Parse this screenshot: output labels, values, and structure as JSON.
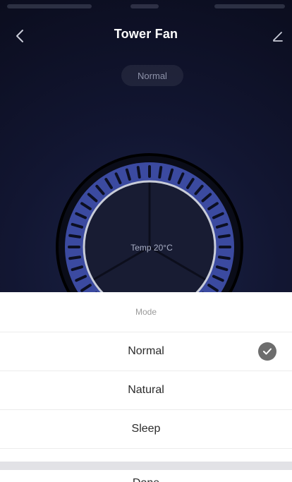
{
  "header": {
    "title": "Tower Fan",
    "current_mode": "Normal"
  },
  "fan": {
    "center_label": "Temp 20°C"
  },
  "mode_sheet": {
    "title": "Mode",
    "options": [
      {
        "label": "Normal",
        "selected": true
      },
      {
        "label": "Natural",
        "selected": false
      },
      {
        "label": "Sleep",
        "selected": false
      }
    ],
    "done_label": "Done"
  },
  "colors": {
    "background": "#121632",
    "dial_blue": "#3b4aa0",
    "sheet": "#ffffff",
    "check": "#6d6d6d"
  },
  "icons": {
    "back": "chevron-left-icon",
    "edit": "pencil-icon",
    "check": "checkmark-icon"
  }
}
